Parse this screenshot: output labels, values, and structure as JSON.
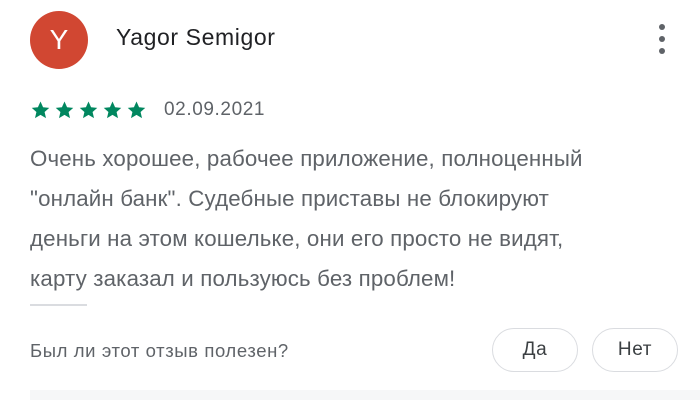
{
  "review": {
    "avatar_letter": "Y",
    "avatar_color": "#d14732",
    "author": "Yagor Semigor",
    "more_icon": "more-vert-icon",
    "rating": 5,
    "rating_max": 5,
    "star_color": "#01875f",
    "date": "02.09.2021",
    "text_lines": [
      "Очень хорошее, рабочее приложение, полноценный",
      "\"онлайн банк\". Судебные приставы не блокируют",
      "деньги на этом кошельке, они его просто не видят,",
      "карту заказал и пользуюсь без проблем!"
    ]
  },
  "helpful": {
    "question": "Был ли этот отзыв полезен?",
    "yes_label": "Да",
    "no_label": "Нет"
  }
}
